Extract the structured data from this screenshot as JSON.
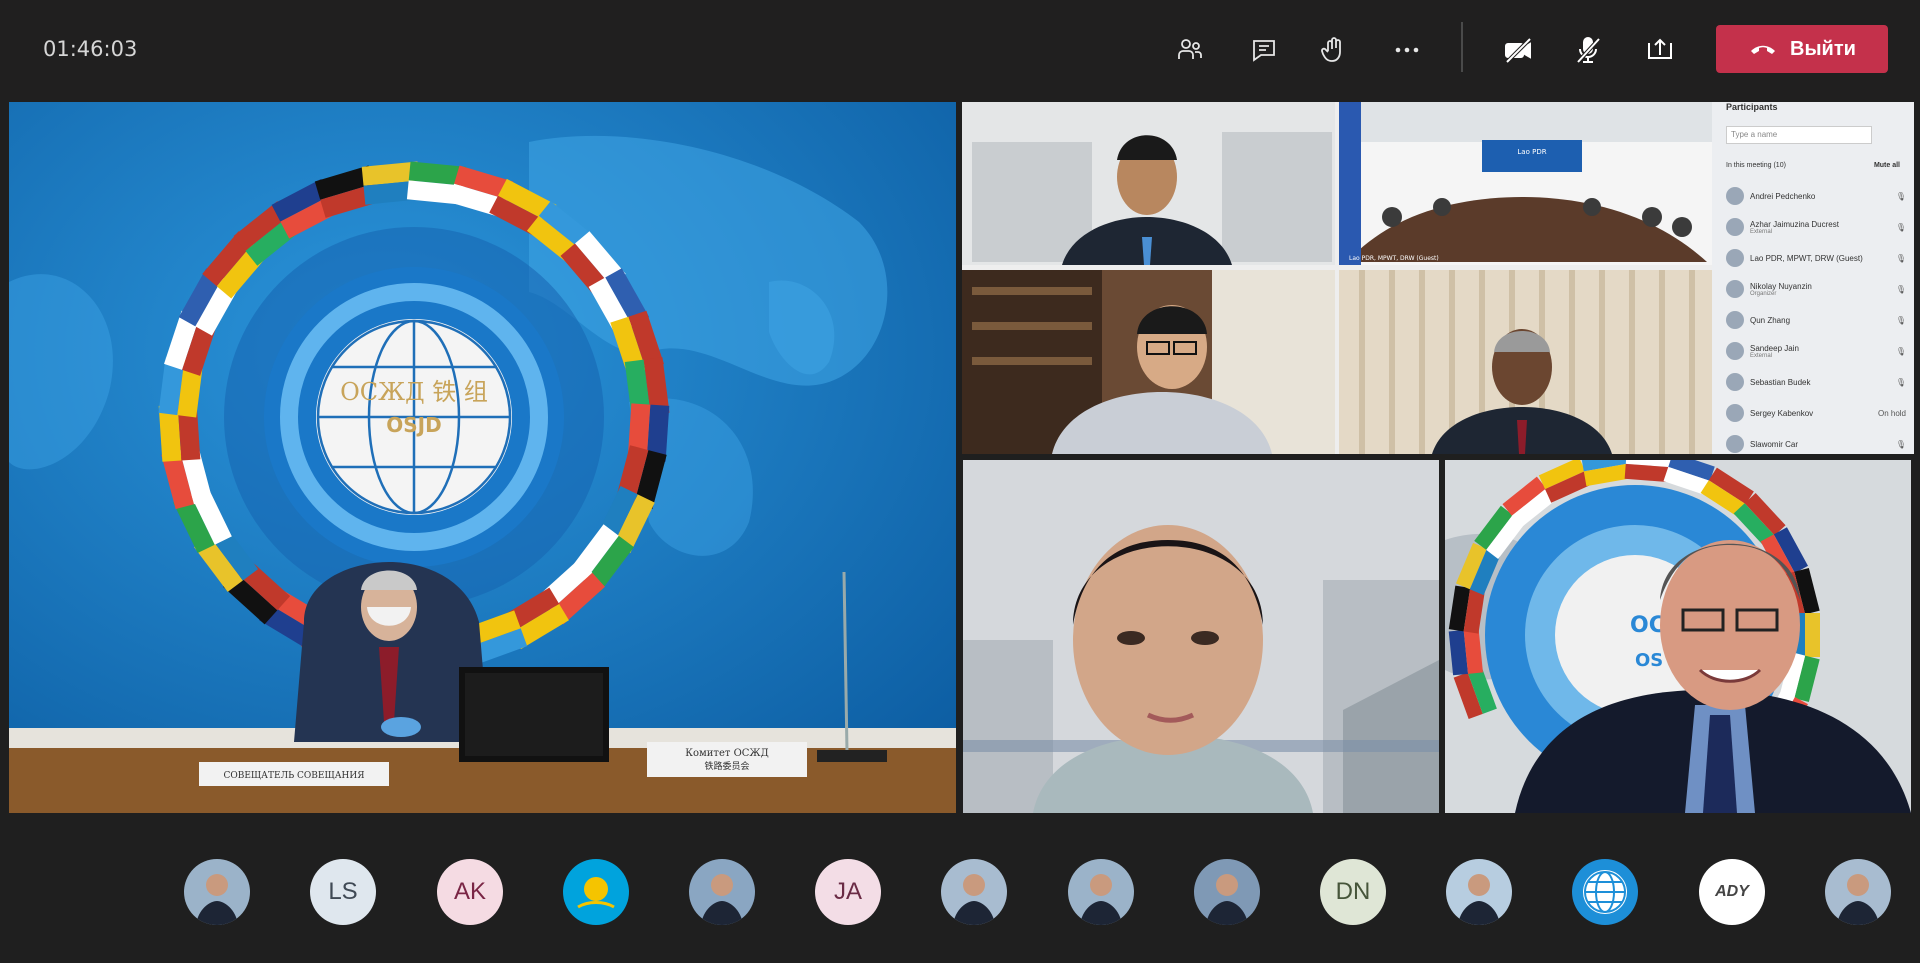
{
  "meeting": {
    "timer": "01:46:03",
    "leave_label": "Выйти"
  },
  "toolbar": {
    "icons": [
      "participants-icon",
      "chat-icon",
      "raise-hand-icon",
      "more-options-icon",
      "camera-off-icon",
      "mic-off-icon",
      "share-screen-icon",
      "hang-up-icon"
    ]
  },
  "main_video": {
    "logo_cyrillic": "ОСЖД  铁 组",
    "logo_latin": "OSJD",
    "nameplate_left": "СОВЕЩАТЕЛЬ СОВЕЩАНИЯ",
    "nameplate_right_line1": "Комитет ОСЖД",
    "nameplate_right_line2": "铁路委员会"
  },
  "shared_screen": {
    "panel_title": "Participants",
    "search_placeholder": "Type a name",
    "in_meeting_label": "In this meeting (10)",
    "mute_all_label": "Mute all",
    "participants": [
      {
        "name": "Andrei Pedchenko",
        "role": ""
      },
      {
        "name": "Azhar Jaimuzina Ducrest",
        "role": "External"
      },
      {
        "name": "Lao PDR, MPWT, DRW (Guest)",
        "role": ""
      },
      {
        "name": "Nikolay Nuyanzin",
        "role": "Organizer"
      },
      {
        "name": "Qun Zhang",
        "role": ""
      },
      {
        "name": "Sandeep Jain",
        "role": "External"
      },
      {
        "name": "Sebastian Budek",
        "role": ""
      },
      {
        "name": "Sergey Kabenkov",
        "role": "On hold"
      },
      {
        "name": "Slawomir Car",
        "role": ""
      }
    ],
    "room_caption": "Lao PDR, MPWT, DRW (Guest)",
    "room_screen_text": "Lao PDR"
  },
  "participant_strip": {
    "avatars": [
      {
        "type": "photo",
        "initials": ""
      },
      {
        "type": "initials",
        "initials": "LS"
      },
      {
        "type": "initials",
        "initials": "AK"
      },
      {
        "type": "flag",
        "initials": ""
      },
      {
        "type": "photo",
        "initials": ""
      },
      {
        "type": "initials",
        "initials": "JA"
      },
      {
        "type": "photo",
        "initials": ""
      },
      {
        "type": "photo",
        "initials": ""
      },
      {
        "type": "photo",
        "initials": ""
      },
      {
        "type": "initials",
        "initials": "DN"
      },
      {
        "type": "photo",
        "initials": ""
      },
      {
        "type": "logo",
        "initials": ""
      },
      {
        "type": "logo",
        "initials": ""
      },
      {
        "type": "photo",
        "initials": ""
      }
    ],
    "logo_text": "ADY"
  },
  "colors": {
    "leave_button": "#c4314b",
    "toolbar_bg": "#201f1f",
    "stage_bg": "#1f1f1f"
  }
}
